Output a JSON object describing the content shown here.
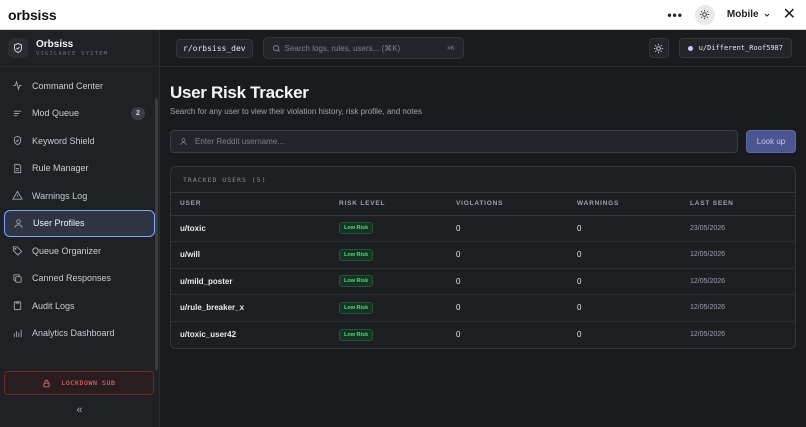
{
  "topbar": {
    "brand": "orbsiss",
    "more_label": "•••",
    "view_mode": "Mobile",
    "close_label": "✕"
  },
  "sidebar": {
    "title": "Orbsiss",
    "subtitle": "VIGILANCE SYSTEM",
    "items": [
      {
        "label": "Command Center",
        "icon": "activity-icon"
      },
      {
        "label": "Mod Queue",
        "icon": "queue-lines-icon",
        "badge": "2"
      },
      {
        "label": "Keyword Shield",
        "icon": "shield-icon"
      },
      {
        "label": "Rule Manager",
        "icon": "document-icon"
      },
      {
        "label": "Warnings Log",
        "icon": "warning-triangle-icon"
      },
      {
        "label": "User Profiles",
        "icon": "user-icon",
        "active": true
      },
      {
        "label": "Queue Organizer",
        "icon": "tag-icon"
      },
      {
        "label": "Canned Responses",
        "icon": "copy-icon"
      },
      {
        "label": "Audit Logs",
        "icon": "clipboard-icon"
      },
      {
        "label": "Analytics Dashboard",
        "icon": "bar-chart-icon"
      }
    ],
    "lockdown_label": "LOCKDOWN SUB",
    "collapse_label": "«"
  },
  "header": {
    "subreddit": "r/orbsiss_dev",
    "search_placeholder": "Search logs, rules, users... (⌘K)",
    "search_shortcut": "⌘K",
    "username": "u/Different_Roof5987"
  },
  "page": {
    "title": "User Risk Tracker",
    "subtitle": "Search for any user to view their violation history, risk profile, and notes",
    "lookup_placeholder": "Enter Reddit username...",
    "lookup_button": "Look up"
  },
  "tracked": {
    "heading": "TRACKED USERS (5)",
    "columns": [
      "USER",
      "RISK LEVEL",
      "VIOLATIONS",
      "WARNINGS",
      "LAST SEEN"
    ],
    "rows": [
      {
        "user": "u/toxic",
        "risk": "Low Risk",
        "violations": "0",
        "warnings": "0",
        "last_seen": "23/05/2026"
      },
      {
        "user": "u/will",
        "risk": "Low Risk",
        "violations": "0",
        "warnings": "0",
        "last_seen": "12/05/2026"
      },
      {
        "user": "u/mild_poster",
        "risk": "Low Risk",
        "violations": "0",
        "warnings": "0",
        "last_seen": "12/05/2026"
      },
      {
        "user": "u/rule_breaker_x",
        "risk": "Low Risk",
        "violations": "0",
        "warnings": "0",
        "last_seen": "12/05/2026"
      },
      {
        "user": "u/toxic_user42",
        "risk": "Low Risk",
        "violations": "0",
        "warnings": "0",
        "last_seen": "12/05/2026"
      }
    ]
  },
  "colors": {
    "accent": "#7ea7ff",
    "danger": "#f87171",
    "success": "#4ade80",
    "button": "#4b5691"
  }
}
